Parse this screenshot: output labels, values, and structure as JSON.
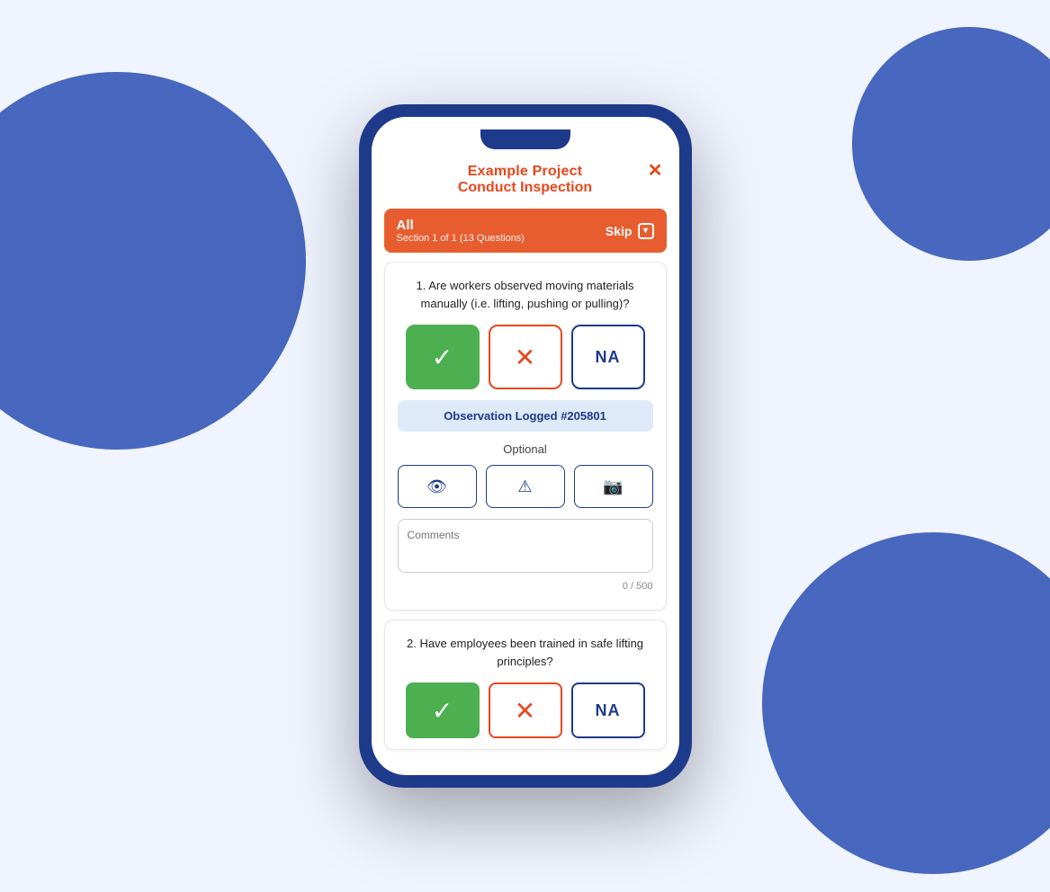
{
  "background": {
    "color": "#dde8ff"
  },
  "header": {
    "project_name": "Example Project",
    "screen_title": "Conduct Inspection",
    "close_label": "✕"
  },
  "section_bar": {
    "title": "All",
    "subtitle": "Section 1 of 1 (13 Questions)",
    "skip_label": "Skip",
    "chevron": "˅"
  },
  "questions": [
    {
      "number": "1.",
      "text": "Are workers observed moving materials manually (i.e. lifting, pushing or pulling)?",
      "answer_selected": "yes",
      "answers": {
        "yes_icon": "✓",
        "no_icon": "✕",
        "na_label": "NA"
      },
      "observation": "Observation Logged #205801",
      "optional_label": "Optional",
      "optional_buttons": [
        {
          "icon": "👁",
          "name": "view-icon"
        },
        {
          "icon": "⚠",
          "name": "warning-icon"
        },
        {
          "icon": "📷",
          "name": "camera-icon"
        }
      ],
      "comments_placeholder": "Comments",
      "char_count": "0 / 500"
    },
    {
      "number": "2.",
      "text": "Have employees been trained in safe lifting principles?",
      "answers": {
        "yes_icon": "✓",
        "no_icon": "✕",
        "na_label": "NA"
      }
    }
  ]
}
